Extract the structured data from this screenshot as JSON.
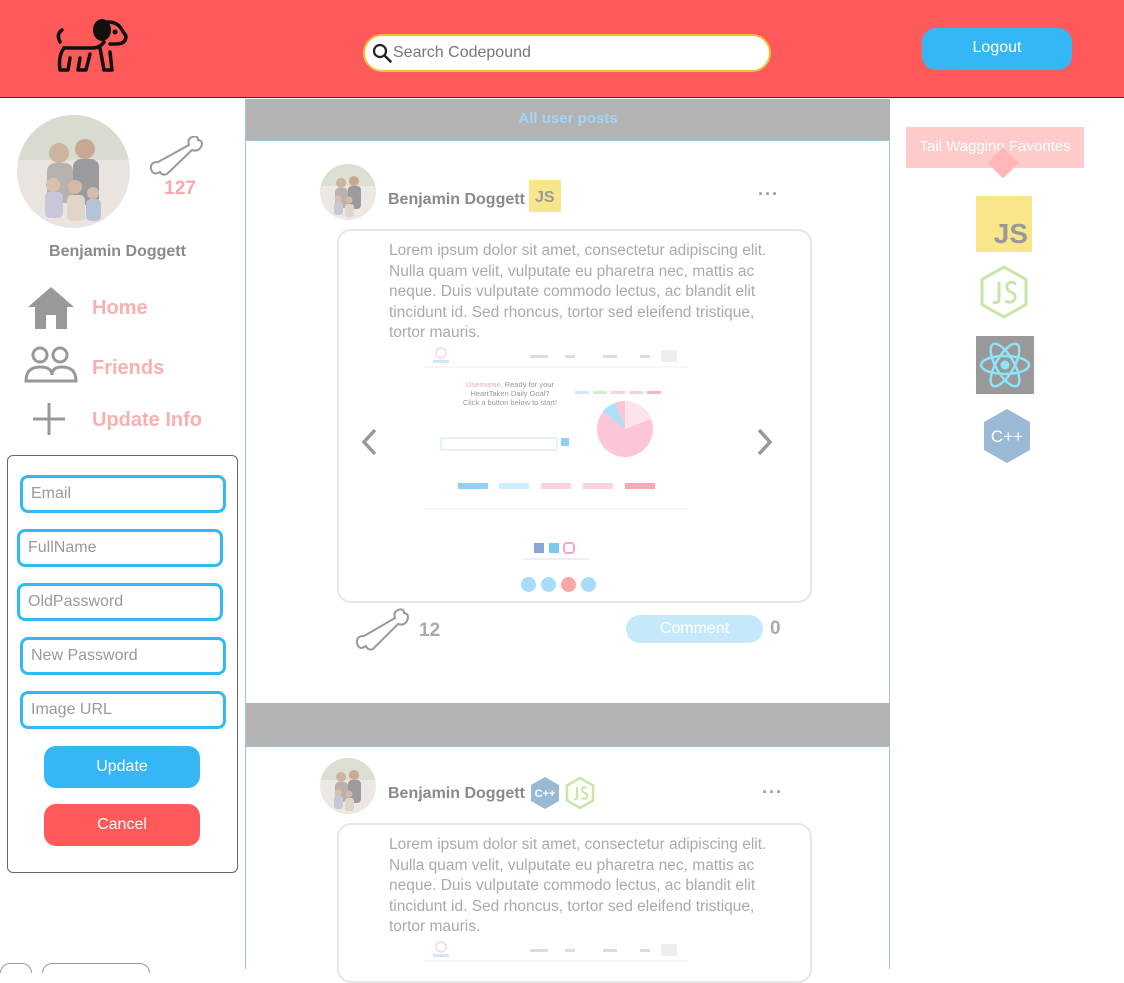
{
  "header": {
    "search_placeholder": "Search Codepound",
    "logout_label": "Logout"
  },
  "profile": {
    "name": "Benjamin Doggett",
    "bone_count": "127"
  },
  "nav": {
    "home": "Home",
    "friends": "Friends",
    "update_info": "Update Info"
  },
  "update_form": {
    "email_placeholder": "Email",
    "fullname_placeholder": "FullName",
    "oldpassword_placeholder": "OldPassword",
    "newpassword_placeholder": "New Password",
    "imageurl_placeholder": "Image URL",
    "update_label": "Update",
    "cancel_label": "Cancel"
  },
  "feed": {
    "header_title": "All user posts",
    "posts": [
      {
        "author": "Benjamin Doggett",
        "badges": [
          "JS"
        ],
        "more": "···",
        "body": "Lorem ipsum dolor sit amet, consectetur adipiscing elit. Nulla quam velit, vulputate eu pharetra nec, mattis ac neque. Duis vulputate commodo lectus, ac blandit elit tincidunt id. Sed rhoncus, tortor sed eleifend tristique, tortor mauris.",
        "screenshot": {
          "greeting_user": "Username,",
          "greeting_rest": "Ready for your",
          "line2": "HeartTaken Daily Goal?",
          "line3": "Click a button below to start!"
        },
        "slides": 4,
        "active_slide": 3,
        "likes": "12",
        "comment_label": "Comment",
        "comments": "0"
      },
      {
        "author": "Benjamin Doggett",
        "badges": [
          "C++",
          "JS"
        ],
        "more": "···",
        "body": "Lorem ipsum dolor sit amet, consectetur adipiscing elit. Nulla quam velit, vulputate eu pharetra nec, mattis ac neque. Duis vulputate commodo lectus, ac blandit elit tincidunt id. Sed rhoncus, tortor sed eleifend tristique, tortor mauris."
      }
    ]
  },
  "favorites": {
    "title": "Tail Wagging Favorites",
    "items": [
      "js-icon",
      "nodejs-icon",
      "react-icon",
      "cpp-icon"
    ],
    "cpp_label": "C++",
    "js_label": "JS"
  },
  "colors": {
    "header_bg": "#ff5a5a",
    "accent_blue": "#35b6f5",
    "cancel_red": "#ff5a5a",
    "search_border": "#f2bd3c",
    "divider_gray": "#b3b3b3"
  }
}
